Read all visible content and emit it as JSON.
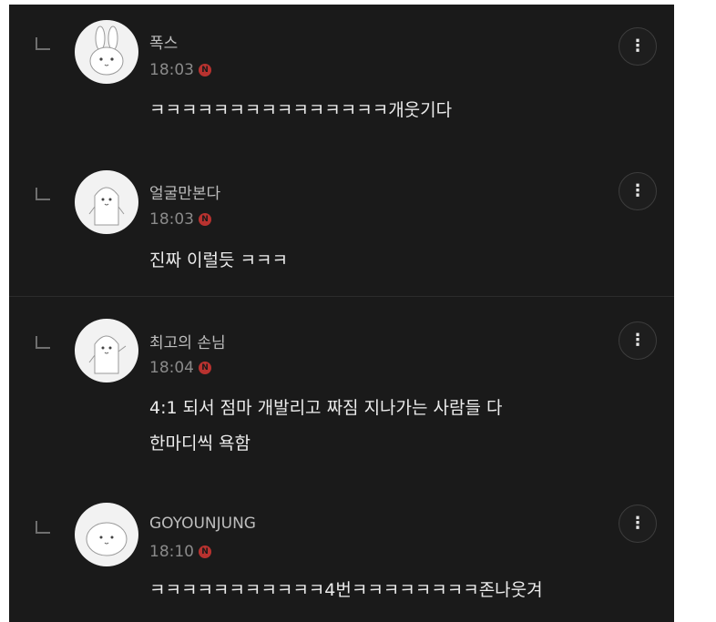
{
  "comments": [
    {
      "author": "폭스",
      "time": "18:03",
      "badge": "N",
      "lines": [
        "ㅋㅋㅋㅋㅋㅋㅋㅋㅋㅋㅋㅋㅋㅋㅋ개웃기다"
      ],
      "avatar_icon": "bunny-avatar-icon"
    },
    {
      "author": "얼굴만본다",
      "time": "18:03",
      "badge": "N",
      "lines": [
        "진짜 이럴듯 ㅋㅋㅋ"
      ],
      "avatar_icon": "character-avatar-icon"
    },
    {
      "author": "최고의 손님",
      "time": "18:04",
      "badge": "N",
      "lines": [
        "4:1 되서 점마 개발리고 짜짐 지나가는 사람들 다",
        "한마디씩 욕함"
      ],
      "avatar_icon": "character-avatar-icon"
    },
    {
      "author": "GOYOUNJUNG",
      "time": "18:10",
      "badge": "N",
      "lines": [
        "ㅋㅋㅋㅋㅋㅋㅋㅋㅋㅋㅋ4번ㅋㅋㅋㅋㅋㅋㅋㅋ존나웃겨"
      ],
      "avatar_icon": "blob-avatar-icon"
    }
  ],
  "more_button_glyph": "⋮",
  "colors": {
    "background": "#1a1a1a",
    "badge": "#b8322f",
    "author": "#bdbdbd",
    "text": "#ececec"
  }
}
